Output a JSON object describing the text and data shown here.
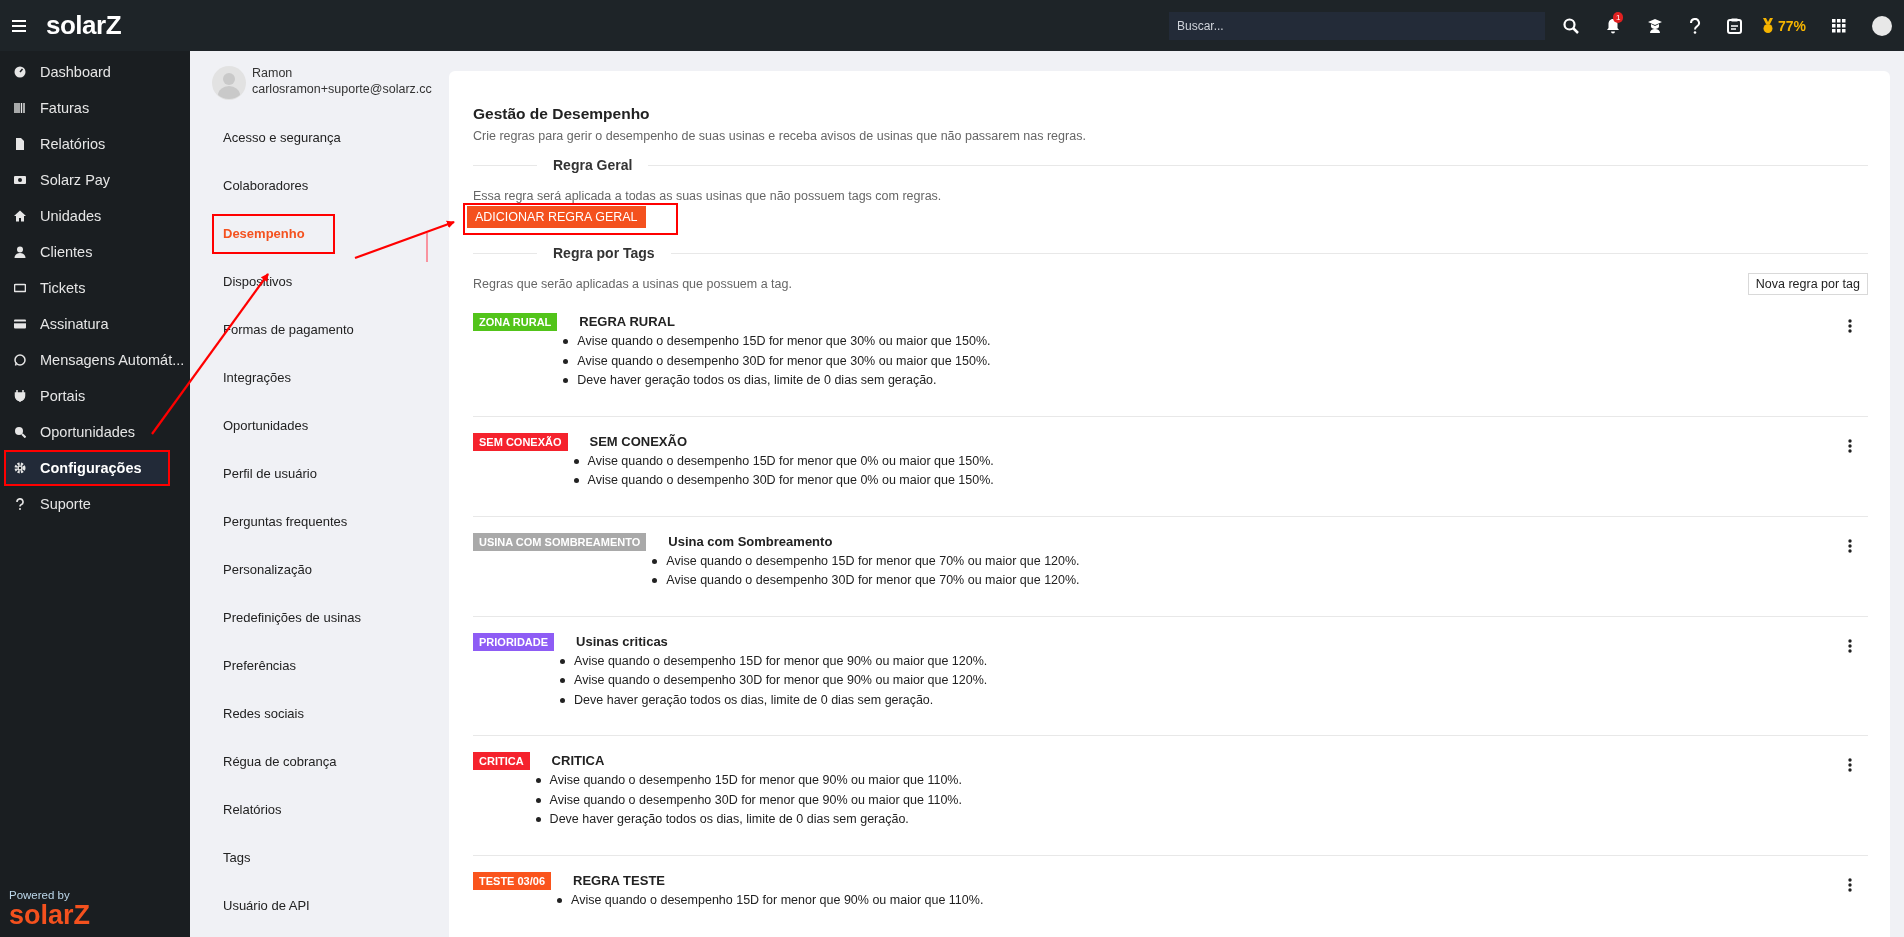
{
  "topbar": {
    "logo": "solarZ",
    "search": {
      "placeholder": "Buscar..."
    },
    "notification_count": "1",
    "score": "77%"
  },
  "sidebar": {
    "items": [
      {
        "label": "Dashboard",
        "selected": false,
        "annotated": false
      },
      {
        "label": "Faturas",
        "selected": false,
        "annotated": false
      },
      {
        "label": "Relatórios",
        "selected": false,
        "annotated": false
      },
      {
        "label": "Solarz Pay",
        "selected": false,
        "annotated": false
      },
      {
        "label": "Unidades",
        "selected": false,
        "annotated": false
      },
      {
        "label": "Clientes",
        "selected": false,
        "annotated": false
      },
      {
        "label": "Tickets",
        "selected": false,
        "annotated": false
      },
      {
        "label": "Assinatura",
        "selected": false,
        "annotated": false
      },
      {
        "label": "Mensagens Automát...",
        "selected": false,
        "annotated": false
      },
      {
        "label": "Portais",
        "selected": false,
        "annotated": false
      },
      {
        "label": "Oportunidades",
        "selected": false,
        "annotated": false
      },
      {
        "label": "Configurações",
        "selected": true,
        "annotated": true
      },
      {
        "label": "Suporte",
        "selected": false,
        "annotated": false
      }
    ],
    "powered_by": "Powered by",
    "footer_logo": "solarZ"
  },
  "profile": {
    "name": "Ramon",
    "email": "carlosramon+suporte@solarz.cc"
  },
  "settings_menu": [
    {
      "label": "Acesso e segurança",
      "selected": false,
      "annotated": false
    },
    {
      "label": "Colaboradores",
      "selected": false,
      "annotated": false
    },
    {
      "label": "Desempenho",
      "selected": true,
      "annotated": true
    },
    {
      "label": "Dispositivos",
      "selected": false,
      "annotated": false
    },
    {
      "label": "Formas de pagamento",
      "selected": false,
      "annotated": false
    },
    {
      "label": "Integrações",
      "selected": false,
      "annotated": false
    },
    {
      "label": "Oportunidades",
      "selected": false,
      "annotated": false
    },
    {
      "label": "Perfil de usuário",
      "selected": false,
      "annotated": false
    },
    {
      "label": "Perguntas frequentes",
      "selected": false,
      "annotated": false
    },
    {
      "label": "Personalização",
      "selected": false,
      "annotated": false
    },
    {
      "label": "Predefinições de usinas",
      "selected": false,
      "annotated": false
    },
    {
      "label": "Preferências",
      "selected": false,
      "annotated": false
    },
    {
      "label": "Redes sociais",
      "selected": false,
      "annotated": false
    },
    {
      "label": "Régua de cobrança",
      "selected": false,
      "annotated": false
    },
    {
      "label": "Relatórios",
      "selected": false,
      "annotated": false
    },
    {
      "label": "Tags",
      "selected": false,
      "annotated": false
    },
    {
      "label": "Usuário de API",
      "selected": false,
      "annotated": false
    }
  ],
  "page": {
    "title": "Gestão de Desempenho",
    "subtitle": "Crie regras para gerir o desempenho de suas usinas e receba avisos de usinas que não passarem nas regras.",
    "general_section": {
      "heading": "Regra Geral",
      "text": "Essa regra será aplicada a todas as suas usinas que não possuem tags com regras.",
      "button": {
        "label": "ADICIONAR REGRA GERAL",
        "annotated": true
      }
    },
    "tags_section": {
      "heading": "Regra por Tags",
      "text": "Regras que serão aplicadas a usinas que possuem a tag.",
      "new_button": "Nova regra por tag"
    },
    "rules": [
      {
        "tag": "ZONA RURAL",
        "color": "#52c41a",
        "title": "REGRA RURAL",
        "conditions": [
          "Avise quando o desempenho 15D for menor que 30% ou maior que 150%.",
          "Avise quando o desempenho 30D for menor que 30% ou maior que 150%.",
          "Deve haver geração todos os dias, limite de 0 dias sem geração."
        ]
      },
      {
        "tag": "SEM CONEXÃO",
        "color": "#f5222d",
        "title": "SEM CONEXÃO",
        "conditions": [
          "Avise quando o desempenho 15D for menor que 0% ou maior que 150%.",
          "Avise quando o desempenho 30D for menor que 0% ou maior que 150%."
        ]
      },
      {
        "tag": "USINA COM SOMBREAMENTO",
        "color": "#a9a9a9",
        "title": "Usina com Sombreamento",
        "conditions": [
          "Avise quando o desempenho 15D for menor que 70% ou maior que 120%.",
          "Avise quando o desempenho 30D for menor que 70% ou maior que 120%."
        ]
      },
      {
        "tag": "PRIORIDADE",
        "color": "#8e5cf5",
        "title": "Usinas criticas",
        "conditions": [
          "Avise quando o desempenho 15D for menor que 90% ou maior que 120%.",
          "Avise quando o desempenho 30D for menor que 90% ou maior que 120%.",
          "Deve haver geração todos os dias, limite de 0 dias sem geração."
        ]
      },
      {
        "tag": "CRITICA",
        "color": "#f5222d",
        "title": "CRITICA",
        "conditions": [
          "Avise quando o desempenho 15D for menor que 90% ou maior que 110%.",
          "Avise quando o desempenho 30D for menor que 90% ou maior que 110%.",
          "Deve haver geração todos os dias, limite de 0 dias sem geração."
        ]
      },
      {
        "tag": "TESTE 03/06",
        "color": "#fa541c",
        "title": "REGRA TESTE",
        "conditions": [
          "Avise quando o desempenho 15D for menor que 90% ou maior que 110%."
        ]
      }
    ]
  }
}
